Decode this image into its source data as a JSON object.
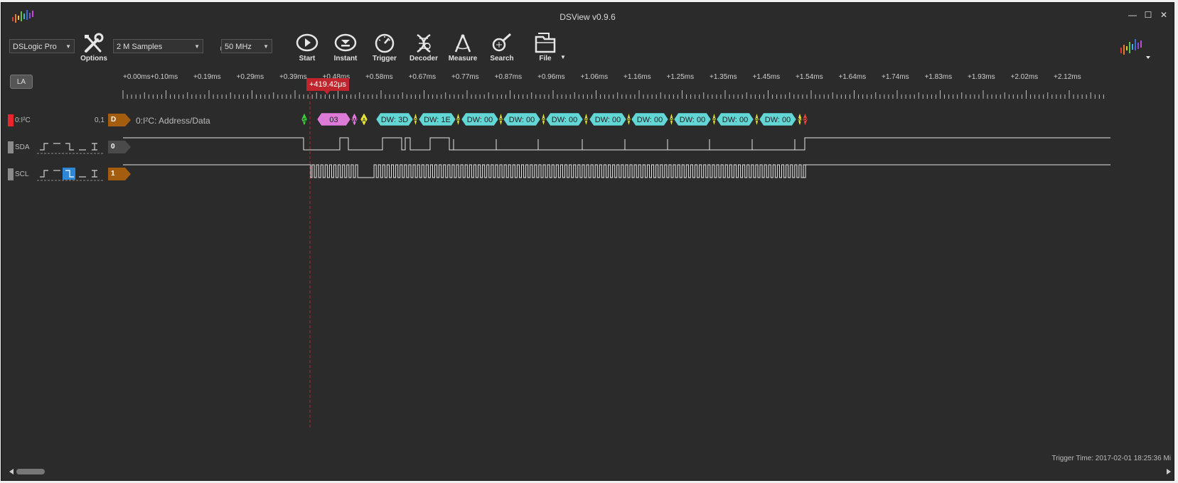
{
  "window": {
    "title": "DSView v0.9.6"
  },
  "window_controls": {
    "minimize": "—",
    "maximize": "☐",
    "close": "✕"
  },
  "toolbar": {
    "device": "DSLogic Pro",
    "samples": "2 M Samples",
    "at": "@",
    "rate": "50 MHz",
    "options_label": "Options",
    "start_label": "Start",
    "instant_label": "Instant",
    "trigger_label": "Trigger",
    "decoder_label": "Decoder",
    "measure_label": "Measure",
    "search_label": "Search",
    "file_label": "File"
  },
  "mode_button": "LA",
  "ruler": {
    "labels": [
      "+0.00ms",
      "+0.10ms",
      "+0.19ms",
      "+0.29ms",
      "+0.39ms",
      "+0.48ms",
      "+0.58ms",
      "+0.67ms",
      "+0.77ms",
      "+0.87ms",
      "+0.96ms",
      "+1.06ms",
      "+1.16ms",
      "+1.25ms",
      "+1.35ms",
      "+1.45ms",
      "+1.54ms",
      "+1.64ms",
      "+1.74ms",
      "+1.83ms",
      "+1.93ms",
      "+2.02ms",
      "+2.12ms"
    ],
    "cursor_label": "+419.42μs"
  },
  "signals": {
    "decoder": {
      "name": "0:I²C",
      "range": "0,1",
      "tag": "D",
      "title": "0:I²C: Address/Data",
      "color": "#e8262b"
    },
    "sda": {
      "name": "SDA",
      "tag": "0",
      "color": "#8a8a8a"
    },
    "scl": {
      "name": "SCL",
      "tag": "1",
      "color": "#8a8a8a"
    }
  },
  "decode_segments": [
    {
      "text": "S",
      "kind": "start",
      "color": "#3fcf3f"
    },
    {
      "text": "03",
      "kind": "address",
      "color": "#de7bd9"
    },
    {
      "text": "W",
      "kind": "rw",
      "color": "#de7bd9"
    },
    {
      "text": "A",
      "kind": "ack",
      "color": "#e4e43c"
    },
    {
      "text": "DW: 3D",
      "kind": "data",
      "color": "#63d6d6"
    },
    {
      "text": "A",
      "kind": "ack",
      "color": "#e4e43c"
    },
    {
      "text": "DW: 1E",
      "kind": "data",
      "color": "#63d6d6"
    },
    {
      "text": "A",
      "kind": "ack",
      "color": "#e4e43c"
    },
    {
      "text": "DW: 00",
      "kind": "data",
      "color": "#63d6d6"
    },
    {
      "text": "A",
      "kind": "ack",
      "color": "#e4e43c"
    },
    {
      "text": "DW: 00",
      "kind": "data",
      "color": "#63d6d6"
    },
    {
      "text": "A",
      "kind": "ack",
      "color": "#e4e43c"
    },
    {
      "text": "DW: 00",
      "kind": "data",
      "color": "#63d6d6"
    },
    {
      "text": "A",
      "kind": "ack",
      "color": "#e4e43c"
    },
    {
      "text": "DW: 00",
      "kind": "data",
      "color": "#63d6d6"
    },
    {
      "text": "A",
      "kind": "ack",
      "color": "#e4e43c"
    },
    {
      "text": "DW: 00",
      "kind": "data",
      "color": "#63d6d6"
    },
    {
      "text": "A",
      "kind": "ack",
      "color": "#e4e43c"
    },
    {
      "text": "DW: 00",
      "kind": "data",
      "color": "#63d6d6"
    },
    {
      "text": "A",
      "kind": "ack",
      "color": "#e4e43c"
    },
    {
      "text": "DW: 00",
      "kind": "data",
      "color": "#63d6d6"
    },
    {
      "text": "A",
      "kind": "ack",
      "color": "#e4e43c"
    },
    {
      "text": "DW: 00",
      "kind": "data",
      "color": "#63d6d6"
    },
    {
      "text": "N",
      "kind": "nack",
      "color": "#e4e43c"
    },
    {
      "text": "P",
      "kind": "stop",
      "color": "#e2463c"
    }
  ],
  "status": {
    "trigger_time": "Trigger Time: 2017-02-01 18:25:36 Mi"
  },
  "colors": {
    "background": "#2b2b2b",
    "wave": "#e6e6e6",
    "cursor": "#c0242c",
    "tag": "#a45c0e"
  }
}
